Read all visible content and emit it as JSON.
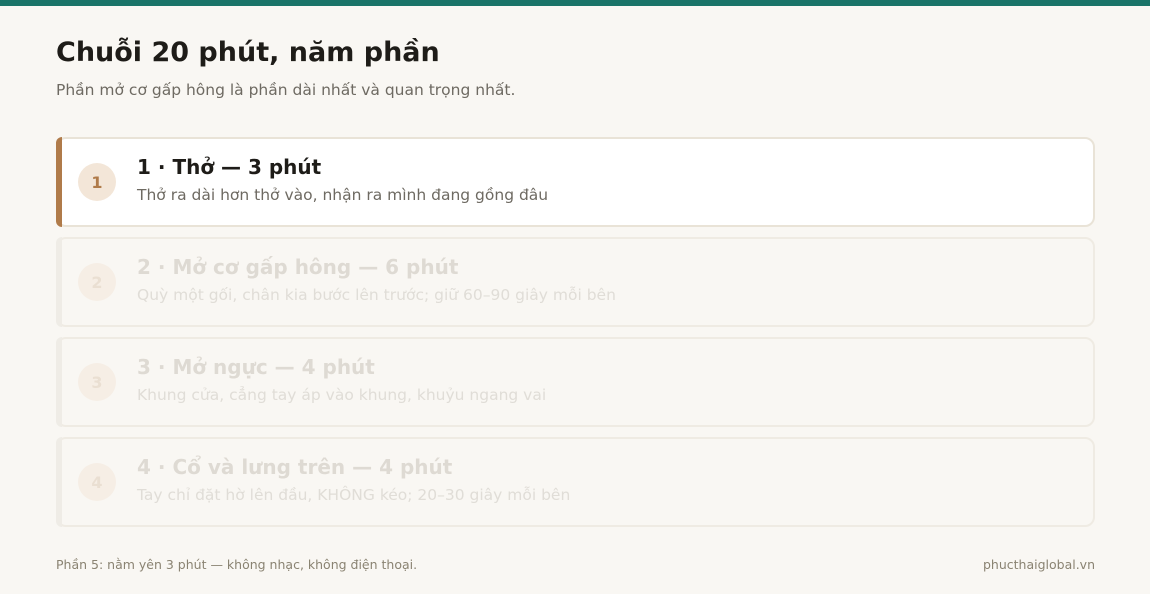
{
  "header": {
    "title": "Chuỗi 20 phút, năm phần",
    "subtitle": "Phần mở cơ gấp hông là phần dài nhất và quan trọng nhất."
  },
  "steps": [
    {
      "number": "1",
      "title": "1 · Thở — 3 phút",
      "description": "Thở ra dài hơn thở vào, nhận ra mình đang gồng đâu",
      "active": true
    },
    {
      "number": "2",
      "title": "2 · Mở cơ gấp hông — 6 phút",
      "description": "Quỳ một gối, chân kia bước lên trước; giữ 60–90 giây mỗi bên",
      "active": false
    },
    {
      "number": "3",
      "title": "3 · Mở ngực — 4 phút",
      "description": "Khung cửa, cẳng tay áp vào khung, khuỷu ngang vai",
      "active": false
    },
    {
      "number": "4",
      "title": "4 · Cổ và lưng trên — 4 phút",
      "description": "Tay chỉ đặt hờ lên đầu, KHÔNG kéo; 20–30 giây mỗi bên",
      "active": false
    }
  ],
  "footer": {
    "note": "Phần 5: nằm yên 3 phút — không nhạc, không điện thoại.",
    "site": "phucthaiglobal.vn"
  },
  "colors": {
    "top_bar": "#1a7468",
    "accent": "#b07b4a",
    "background": "#f9f7f3"
  }
}
